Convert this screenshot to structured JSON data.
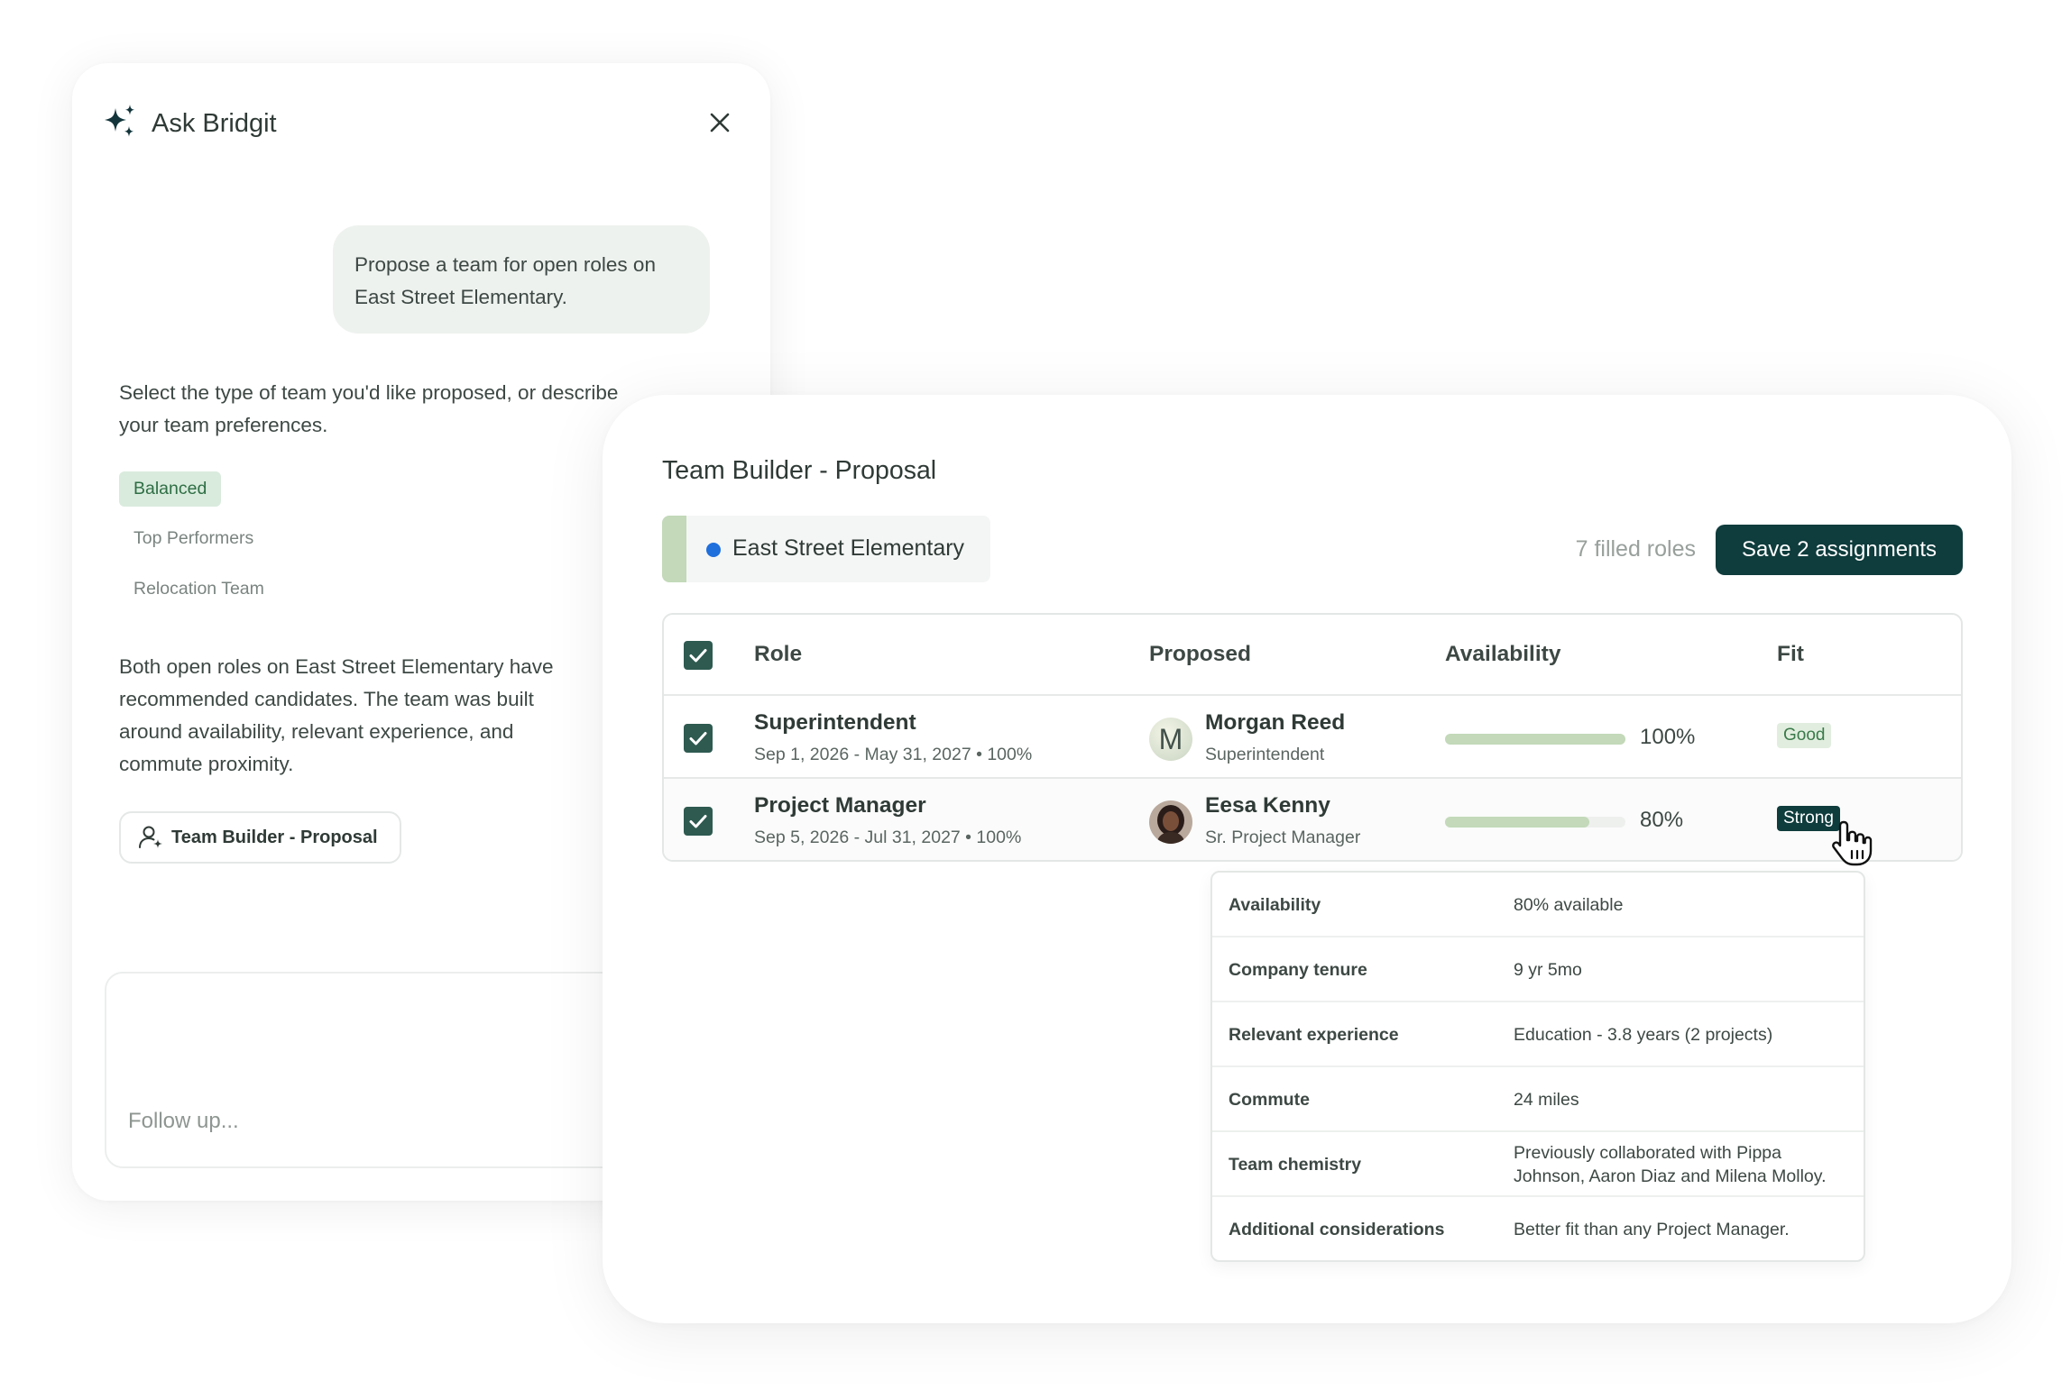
{
  "chat": {
    "title": "Ask Bridgit",
    "user_message": "Propose a team for open roles on East Street Elementary.",
    "assistant_prompt": "Select the type of team you'd like proposed, or describe your team preferences.",
    "options": [
      "Balanced",
      "Top Performers",
      "Relocation Team"
    ],
    "selected_option": "Balanced",
    "assistant_result": "Both open roles on East Street Elementary have recommended candidates. The team was built around availability, relevant experience, and commute proximity.",
    "proposal_chip": "Team Builder - Proposal",
    "followup_placeholder": "Follow up..."
  },
  "team_builder": {
    "title": "Team Builder - Proposal",
    "project_name": "East Street Elementary",
    "filled_roles": "7 filled roles",
    "save_button": "Save 2 assignments",
    "columns": [
      "Role",
      "Proposed",
      "Availability",
      "Fit"
    ],
    "rows": [
      {
        "role": "Superintendent",
        "dates": "Sep 1, 2026 - May 31, 2027  • 100%",
        "person": "Morgan Reed",
        "person_title": "Superintendent",
        "avatar_initial": "M",
        "availability": "100%",
        "availability_fraction": 1.0,
        "fit": "Good",
        "checked": true
      },
      {
        "role": "Project Manager",
        "dates": "Sep 5, 2026 - Jul 31, 2027  • 100%",
        "person": "Eesa Kenny",
        "person_title": "Sr. Project Manager",
        "availability": "80%",
        "availability_fraction": 0.8,
        "fit": "Strong",
        "checked": true
      }
    ],
    "details": [
      {
        "label": "Availability",
        "value": "80% available"
      },
      {
        "label": "Company tenure",
        "value": "9 yr 5mo"
      },
      {
        "label": "Relevant experience",
        "value": "Education - 3.8 years (2 projects)"
      },
      {
        "label": "Commute",
        "value": "24 miles"
      },
      {
        "label": "Team chemistry",
        "value": "Previously collaborated with Pippa Johnson, Aaron Diaz and Milena Molloy."
      },
      {
        "label": "Additional considerations",
        "value": "Better fit than any Project Manager."
      }
    ]
  },
  "colors": {
    "primary_dark": "#0f3c3d",
    "checkbox": "#2e5a50",
    "availability_bar": "#c3d9b9",
    "project_dot": "#1f6fdc",
    "balanced_bg": "#d9ebdd",
    "good_badge_bg": "#e1eedf"
  }
}
